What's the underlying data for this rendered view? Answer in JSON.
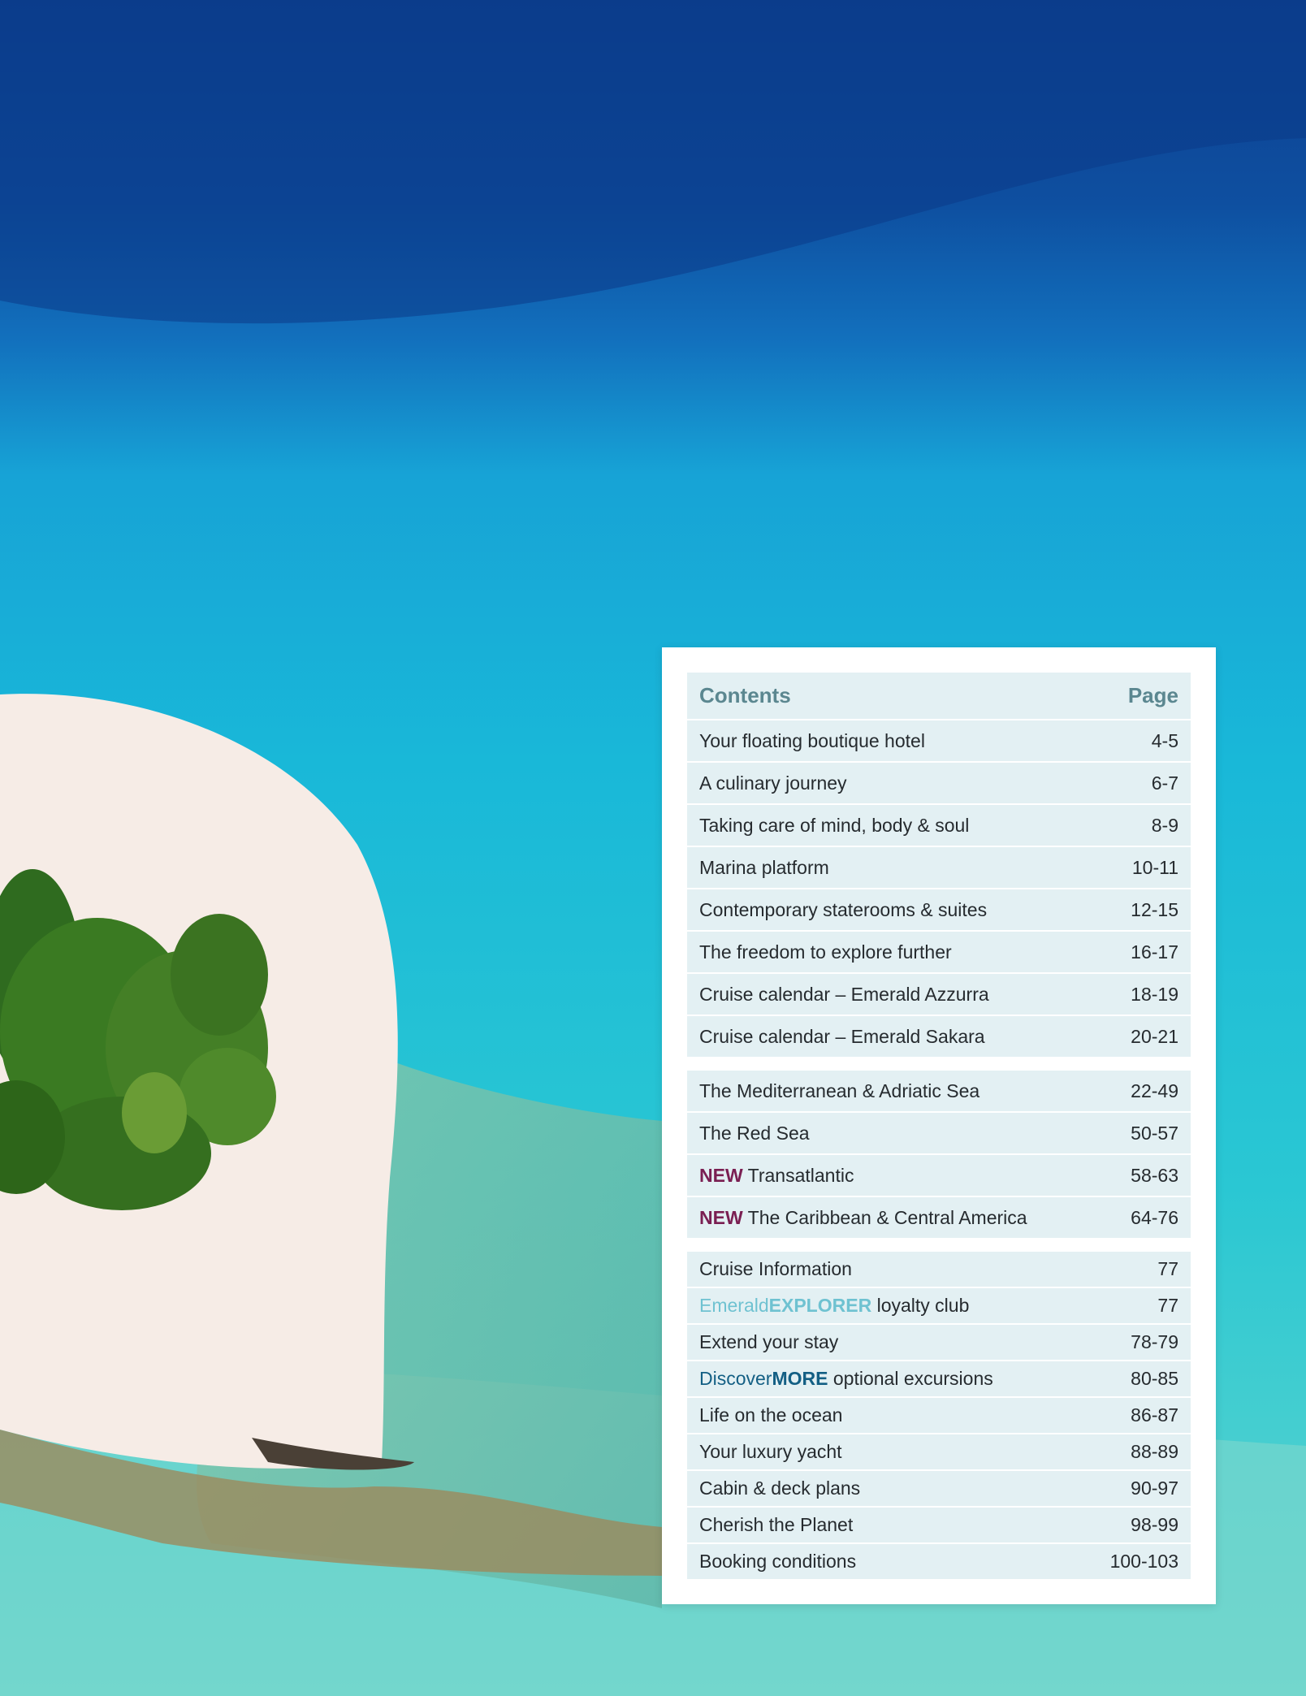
{
  "colors": {
    "deep_ocean": "#0e4fa0",
    "lagoon": "#1ab8d6",
    "shallows": "#6fd9d6",
    "sand": "#f6ece6",
    "vegetation": "#3a7a22",
    "table_row": "#e3f0f3",
    "header_text": "#5b8790",
    "new_badge": "#7a1f52"
  },
  "contents": {
    "header": {
      "title": "Contents",
      "page": "Page"
    },
    "section1": [
      {
        "title": "Your floating boutique hotel",
        "page": "4-5"
      },
      {
        "title": "A culinary journey",
        "page": "6-7"
      },
      {
        "title": "Taking care of mind, body & soul",
        "page": "8-9"
      },
      {
        "title": "Marina platform",
        "page": "10-11"
      },
      {
        "title": "Contemporary staterooms & suites",
        "page": "12-15"
      },
      {
        "title": "The freedom to explore further",
        "page": "16-17"
      },
      {
        "title": "Cruise calendar – Emerald Azzurra",
        "page": "18-19"
      },
      {
        "title": "Cruise calendar – Emerald Sakara",
        "page": "20-21"
      }
    ],
    "section2": [
      {
        "title": "The Mediterranean & Adriatic Sea",
        "page": "22-49"
      },
      {
        "title": "The Red Sea",
        "page": "50-57"
      },
      {
        "badge": "NEW",
        "title": "Transatlantic",
        "page": "58-63"
      },
      {
        "badge": "NEW",
        "title": "The Caribbean & Central America",
        "page": "64-76"
      }
    ],
    "section3": [
      {
        "title": "Cruise Information",
        "page": "77"
      },
      {
        "brand_a": "Emerald",
        "brand_b": "EXPLORER",
        "title": "loyalty club",
        "page": "77"
      },
      {
        "title": "Extend your stay",
        "page": "78-79"
      },
      {
        "brand_a": "Discover",
        "brand_b": "MORE",
        "title": "optional excursions",
        "page": "80-85"
      },
      {
        "title": "Life on the ocean",
        "page": "86-87"
      },
      {
        "title": "Your luxury yacht",
        "page": "88-89"
      },
      {
        "title": "Cabin & deck plans",
        "page": "90-97"
      },
      {
        "title": "Cherish the Planet",
        "page": "98-99"
      },
      {
        "title": "Booking conditions",
        "page": "100-103"
      }
    ]
  }
}
